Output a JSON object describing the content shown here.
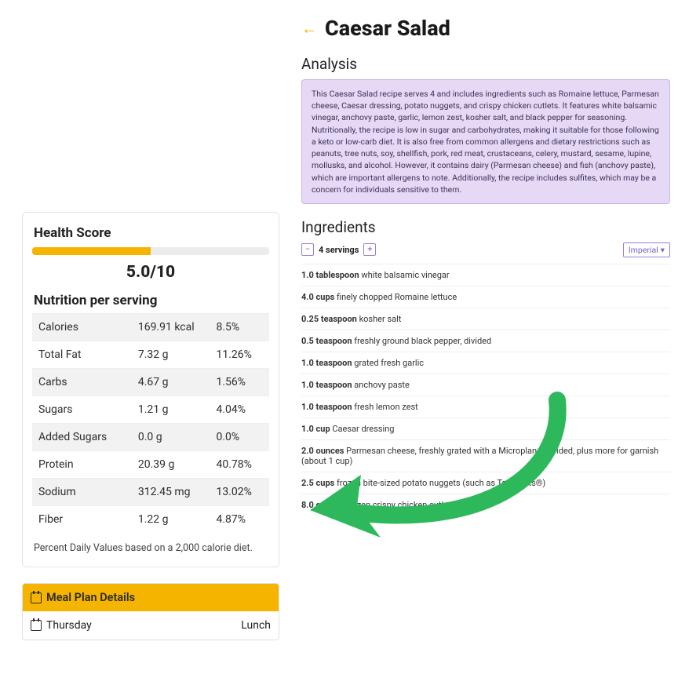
{
  "page": {
    "title": "Caesar Salad"
  },
  "analysis": {
    "heading": "Analysis",
    "text": "This Caesar Salad recipe serves 4 and includes ingredients such as Romaine lettuce, Parmesan cheese, Caesar dressing, potato nuggets, and crispy chicken cutlets. It features white balsamic vinegar, anchovy paste, garlic, lemon zest, kosher salt, and black pepper for seasoning. Nutritionally, the recipe is low in sugar and carbohydrates, making it suitable for those following a keto or low-carb diet. It is also free from common allergens and dietary restrictions such as peanuts, tree nuts, soy, shellfish, pork, red meat, crustaceans, celery, mustard, sesame, lupine, mollusks, and alcohol. However, it contains dairy (Parmesan cheese) and fish (anchovy paste), which are important allergens to note. Additionally, the recipe includes sulfites, which may be a concern for individuals sensitive to them."
  },
  "ingredients": {
    "heading": "Ingredients",
    "servings_label": "4 servings",
    "unit_label": "Imperial",
    "items": [
      {
        "amount": "1.0 tablespoon",
        "name": "white balsamic vinegar"
      },
      {
        "amount": "4.0 cups",
        "name": "finely chopped Romaine lettuce"
      },
      {
        "amount": "0.25 teaspoon",
        "name": "kosher salt"
      },
      {
        "amount": "0.5 teaspoon",
        "name": "freshly ground black pepper, divided"
      },
      {
        "amount": "1.0 teaspoon",
        "name": "grated fresh garlic"
      },
      {
        "amount": "1.0 teaspoon",
        "name": "anchovy paste"
      },
      {
        "amount": "1.0 teaspoon",
        "name": "fresh lemon zest"
      },
      {
        "amount": "1.0 cup",
        "name": "Caesar dressing"
      },
      {
        "amount": "2.0 ounces",
        "name": "Parmesan cheese, freshly grated with a Microplane, divided, plus more for garnish (about 1 cup)"
      },
      {
        "amount": "2.5 cups",
        "name": "frozen bite-sized potato nuggets (such as Tater Tots®)"
      },
      {
        "amount": "8.0 ounces",
        "name": "frozen crispy chicken cutlets"
      }
    ]
  },
  "health": {
    "title": "Health Score",
    "score_text": "5.0/10",
    "np_title": "Nutrition per serving",
    "rows": [
      {
        "label": "Calories",
        "value": "169.91 kcal",
        "pct": "8.5%"
      },
      {
        "label": "Total Fat",
        "value": "7.32 g",
        "pct": "11.26%"
      },
      {
        "label": "Carbs",
        "value": "4.67 g",
        "pct": "1.56%"
      },
      {
        "label": "Sugars",
        "value": "1.21 g",
        "pct": "4.04%"
      },
      {
        "label": "Added Sugars",
        "value": "0.0 g",
        "pct": "0.0%"
      },
      {
        "label": "Protein",
        "value": "20.39 g",
        "pct": "40.78%"
      },
      {
        "label": "Sodium",
        "value": "312.45 mg",
        "pct": "13.02%"
      },
      {
        "label": "Fiber",
        "value": "1.22 g",
        "pct": "4.87%"
      }
    ],
    "footnote": "Percent Daily Values based on a 2,000 calorie diet."
  },
  "meal_plan": {
    "heading": "Meal Plan Details",
    "day": "Thursday",
    "meal": "Lunch"
  }
}
